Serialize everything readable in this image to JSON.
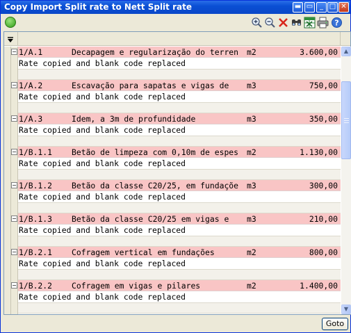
{
  "window": {
    "title": "Copy Import Split rate to Nett Split rate"
  },
  "toolbar": {
    "icons": [
      "back-icon",
      "zoom-in-icon",
      "zoom-out-icon",
      "delete-icon",
      "find-icon",
      "excel-export-icon",
      "print-icon",
      "help-icon"
    ]
  },
  "grid": {
    "header_icon": "filter-dropdown-icon",
    "records": [
      {
        "code": "1/A.1",
        "description": "Decapagem e regularização do terren",
        "unit": "m2",
        "rate": "3.600,00",
        "note": "Rate copied and blank code replaced"
      },
      {
        "code": "1/A.2",
        "description": "Escavação para sapatas e vigas de",
        "unit": "m3",
        "rate": "750,00",
        "note": "Rate copied and blank code replaced"
      },
      {
        "code": "1/A.3",
        "description": "Idem, a 3m de profundidade",
        "unit": "m3",
        "rate": "350,00",
        "note": "Rate copied and blank code replaced"
      },
      {
        "code": "1/B.1.1",
        "description": "Betão de limpeza com 0,10m de espes",
        "unit": "m2",
        "rate": "1.130,00",
        "note": "Rate copied and blank code replaced"
      },
      {
        "code": "1/B.1.2",
        "description": "Betão da classe C20/25, em fundaçõe",
        "unit": "m3",
        "rate": "300,00",
        "note": "Rate copied and blank code replaced"
      },
      {
        "code": "1/B.1.3",
        "description": "Betão da classe C20/25 em vigas e",
        "unit": "m3",
        "rate": "210,00",
        "note": "Rate copied and blank code replaced"
      },
      {
        "code": "1/B.2.1",
        "description": "Cofragem vertical em fundações",
        "unit": "m2",
        "rate": "800,00",
        "note": "Rate copied and blank code replaced"
      },
      {
        "code": "1/B.2.2",
        "description": "Cofragem em vigas e pilares",
        "unit": "m2",
        "rate": "1.400,00",
        "note": "Rate copied and blank code replaced"
      }
    ]
  },
  "footer": {
    "goto_label": "Goto"
  },
  "colors": {
    "title_bar": "#0a4fd4",
    "row_highlight": "#f9c5c5"
  }
}
